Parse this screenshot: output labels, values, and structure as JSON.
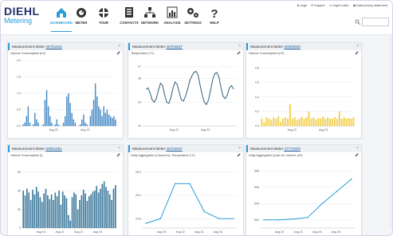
{
  "brand": {
    "name": "DIEHL",
    "sub": "Metering"
  },
  "nav": [
    {
      "label": "DASHBOARD",
      "icon": "home-icon"
    },
    {
      "label": "METER",
      "icon": "meter-icon"
    },
    {
      "label": "TOUR",
      "icon": "tour-icon"
    },
    {
      "label": "CONTACTS",
      "icon": "contacts-icon"
    },
    {
      "label": "NETWORK",
      "icon": "network-icon"
    },
    {
      "label": "ANALYSIS",
      "icon": "analysis-icon"
    },
    {
      "label": "SETTINGS",
      "icon": "settings-icon"
    },
    {
      "label": "HELP",
      "icon": "help-icon"
    }
  ],
  "toplinks": {
    "user": "ange",
    "support": "Support",
    "legal": "Legal notice",
    "privacy": "Data privacy statement"
  },
  "colors": {
    "accent": "#2a9cd8",
    "navy": "#23306b",
    "series_blue": "#4a8cc7",
    "series_dark": "#2f5d7a",
    "series_yellow": "#f3d25a",
    "series_steel": "#3f7a9c"
  },
  "widgets": [
    {
      "title_prefix": "Measurement Meter",
      "meter_id": "45751844",
      "subtitle": "Volume Consumption (m³)",
      "chart_data": {
        "type": "bar",
        "color": "#4a8cc7",
        "xticks": [
          "Aug 22",
          "Aug 23"
        ],
        "yticks": [
          "0.0",
          "0.5",
          "1.0",
          "1.5",
          "2.0"
        ],
        "ylim": [
          0,
          2
        ],
        "values": [
          0.05,
          0.1,
          0.3,
          0.6,
          0.1,
          0,
          0.05,
          0.4,
          0.2,
          0.1,
          0,
          0,
          0.05,
          0.8,
          1.1,
          0.6,
          0.3,
          0.1,
          0,
          0.05,
          0.2,
          0.05,
          0,
          0,
          0.1,
          0.3,
          0.9,
          1.0,
          0.7,
          0.4,
          0.2,
          0.1,
          0,
          0,
          0.05,
          0.2,
          0.35,
          0.1,
          0.05,
          0,
          0.3,
          0.5,
          0.8,
          1.3,
          0.9,
          0.6,
          0.5,
          0.3,
          0.6,
          0.4,
          0.5,
          0.35,
          0.3,
          0.25,
          0.3,
          0.2
        ]
      }
    },
    {
      "title_prefix": "Measurement Meter",
      "meter_id": "40703637",
      "subtitle": "Temperature (°C)",
      "chart_data": {
        "type": "line",
        "color": "#2f5d7a",
        "xticks": [
          "Aug 22",
          "Aug 23"
        ],
        "yticks": [
          "22",
          "24",
          "26",
          "27"
        ],
        "ylim": [
          22,
          27.5
        ],
        "values": [
          25.1,
          25.2,
          24.8,
          24.2,
          24.0,
          24.3,
          25.0,
          25.6,
          25.4,
          24.6,
          24.0,
          23.9,
          24.4,
          25.2,
          25.7,
          25.5,
          24.8,
          24.2,
          24.1,
          24.5,
          25.1,
          25.8,
          26.2,
          26.5,
          26.6,
          26.3,
          25.4,
          24.6,
          24.0,
          23.8,
          24.2,
          25.0,
          25.9,
          26.4,
          26.5,
          26.1,
          25.2,
          24.5,
          24.3,
          24.6,
          25.2,
          25.4,
          25.1
        ]
      }
    },
    {
      "title_prefix": "Measurement Meter",
      "meter_id": "30500526",
      "subtitle": "Volume Consumption (m³)",
      "chart_data": {
        "type": "bar",
        "color": "#f3d25a",
        "xticks": [
          "Aug 22",
          "Aug 23"
        ],
        "yticks": [
          "0.0",
          "0.2",
          "0.4",
          "0.6",
          "0.8"
        ],
        "ylim": [
          0,
          0.9
        ],
        "values": [
          0.1,
          0.05,
          0.12,
          0.1,
          0.08,
          0.12,
          0.1,
          0.13,
          0.06,
          0.1,
          0.12,
          0.1,
          0.3,
          0.1,
          0.12,
          0.08,
          0.1,
          0.13,
          0.1,
          0.12,
          0.2,
          0.1,
          0.12,
          0.09,
          0.11,
          0.1,
          0.13,
          0.1,
          0.12,
          0.1,
          0.1,
          0.12,
          0.1,
          0.2,
          0.1,
          0.12,
          0.1,
          0.11,
          0.1,
          0.12
        ]
      }
    },
    {
      "title_prefix": "Measurement Meter",
      "meter_id": "30561551",
      "subtitle": "Volume Consumption (l)",
      "chart_data": {
        "type": "bar",
        "color": "#3f7a9c",
        "xticks": [
          "Aug 20",
          "Aug 21",
          "Aug 22",
          "Aug 23"
        ],
        "yticks": [
          "0",
          "20",
          "40",
          "60"
        ],
        "ylim": [
          0,
          70
        ],
        "values": [
          40,
          35,
          42,
          38,
          30,
          41,
          36,
          44,
          39,
          33,
          28,
          37,
          42,
          35,
          31,
          36,
          30,
          38,
          34,
          40,
          25,
          39,
          35,
          32,
          14,
          8,
          33,
          38,
          36,
          20,
          30,
          35,
          41,
          37,
          29,
          34,
          36,
          39,
          40,
          45,
          38,
          42,
          47,
          50,
          44,
          40,
          36,
          30,
          42,
          46
        ]
      }
    },
    {
      "title_prefix": "Measurement Meter",
      "meter_id": "40703637",
      "subtitle": "Daily Aggregation (Closed to): Temperature (°C)",
      "chart_data": {
        "type": "line",
        "color": "#2a9cd8",
        "xticks": [
          "Aug 20",
          "Aug 22",
          "Aug 24",
          "Aug 26"
        ],
        "x": [
          20,
          21,
          22,
          23,
          24,
          25,
          26
        ],
        "yticks": [
          "24.0",
          "25.0",
          "26.0"
        ],
        "ylim": [
          23.6,
          26.4
        ],
        "values": [
          23.8,
          24.0,
          25.5,
          25.5,
          24.3,
          24.0,
          24.0
        ]
      }
    },
    {
      "title_prefix": "Measurement Meter",
      "meter_id": "47772903",
      "subtitle": "Daily Aggregation (Last of): Volume (m³)",
      "chart_data": {
        "type": "line",
        "color": "#2a9cd8",
        "xticks": [
          "Aug 20",
          "Aug 22",
          "Aug 24",
          "Aug 26"
        ],
        "x": [
          20,
          21,
          22,
          23,
          24,
          25,
          26
        ],
        "yticks": [
          "502",
          "504",
          "506",
          "508"
        ],
        "ylim": [
          501,
          509
        ],
        "values": [
          502.0,
          502.0,
          502.1,
          502.3,
          504.0,
          505.5,
          507.0
        ]
      }
    }
  ]
}
